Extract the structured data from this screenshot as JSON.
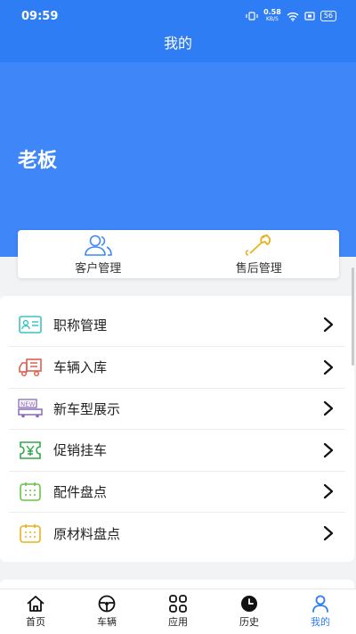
{
  "status_bar": {
    "time": "09:59",
    "net_speed": "0.58",
    "net_unit": "KB/S",
    "battery": "56"
  },
  "header": {
    "title": "我的"
  },
  "profile": {
    "name": "老板"
  },
  "quick_actions": [
    {
      "label": "客户管理",
      "icon": "users-icon"
    },
    {
      "label": "售后管理",
      "icon": "wrench-icon"
    }
  ],
  "menu": [
    {
      "label": "职称管理",
      "icon": "id-card-icon",
      "color": "#3bc4c4"
    },
    {
      "label": "车辆入库",
      "icon": "truck-icon",
      "color": "#e0604f"
    },
    {
      "label": "新车型展示",
      "icon": "new-car-icon",
      "color": "#8a6bb8"
    },
    {
      "label": "促销挂车",
      "icon": "ticket-yuan-icon",
      "color": "#2fa84a"
    },
    {
      "label": "配件盘点",
      "icon": "calendar-icon",
      "color": "#6cc24a"
    },
    {
      "label": "原材料盘点",
      "icon": "calendar-icon",
      "color": "#e9b21b"
    }
  ],
  "tabs": [
    {
      "label": "首页",
      "icon": "home-icon",
      "active": false
    },
    {
      "label": "车辆",
      "icon": "steering-wheel-icon",
      "active": false
    },
    {
      "label": "应用",
      "icon": "apps-grid-icon",
      "active": false
    },
    {
      "label": "历史",
      "icon": "clock-icon",
      "active": false
    },
    {
      "label": "我的",
      "icon": "user-icon",
      "active": true
    }
  ],
  "colors": {
    "primary": "#2f7df4",
    "banner": "#3f86f8"
  }
}
